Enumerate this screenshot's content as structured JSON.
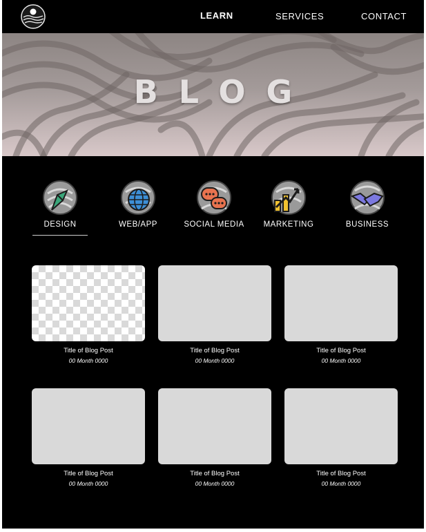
{
  "nav": {
    "links": [
      {
        "label": "LEARN",
        "active": true
      },
      {
        "label": "SERVICES",
        "active": false
      },
      {
        "label": "CONTACT",
        "active": false
      }
    ]
  },
  "hero": {
    "title": "BLOG"
  },
  "categories": [
    {
      "label": "DESIGN",
      "icon": "pen-nib-icon",
      "selected": true
    },
    {
      "label": "WEB/APP",
      "icon": "globe-icon",
      "selected": false
    },
    {
      "label": "SOCIAL MEDIA",
      "icon": "chat-bubbles-icon",
      "selected": false
    },
    {
      "label": "MARKETING",
      "icon": "chart-arrow-icon",
      "selected": false
    },
    {
      "label": "BUSINESS",
      "icon": "handshake-icon",
      "selected": false
    }
  ],
  "posts": [
    {
      "title": "Title of Blog Post",
      "date": "00 Month 0000"
    },
    {
      "title": "Title of Blog Post",
      "date": "00 Month 0000"
    },
    {
      "title": "Title of Blog Post",
      "date": "00 Month 0000"
    },
    {
      "title": "Title of Blog Post",
      "date": "00 Month 0000"
    },
    {
      "title": "Title of Blog Post",
      "date": "00 Month 0000"
    },
    {
      "title": "Title of Blog Post",
      "date": "00 Month 0000"
    }
  ],
  "colors": {
    "background": "#000000",
    "thumbnail": "#d9d9d9",
    "text": "#ffffff"
  }
}
